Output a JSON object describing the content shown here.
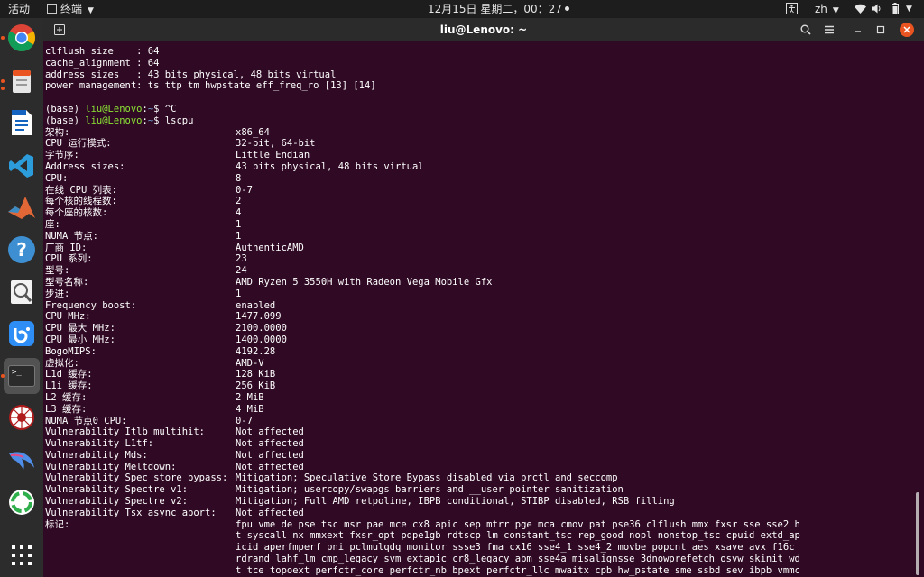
{
  "topbar": {
    "activities": "活动",
    "app_menu_label": "终端",
    "clock": "12月15日 星期二，00：27",
    "input_method": "zh"
  },
  "dock": {
    "items": [
      {
        "name": "chrome-icon",
        "label": ""
      },
      {
        "name": "files-icon",
        "label": ""
      },
      {
        "name": "libreoffice-writer-icon",
        "label": ""
      },
      {
        "name": "vscode-icon",
        "label": ""
      },
      {
        "name": "matlab-icon",
        "label": ""
      },
      {
        "name": "help-icon",
        "label": "?"
      },
      {
        "name": "image-viewer-icon",
        "label": ""
      },
      {
        "name": "baidu-netdisk-icon",
        "label": ""
      },
      {
        "name": "terminal-icon",
        "label": ">_"
      },
      {
        "name": "spider-icon",
        "label": ""
      },
      {
        "name": "kali-dragon-icon",
        "label": ""
      },
      {
        "name": "recycle-app-icon",
        "label": ""
      },
      {
        "name": "show-applications-icon",
        "label": ""
      }
    ]
  },
  "window": {
    "title": "liu@Lenovo: ~"
  },
  "terminal": {
    "pre_lines": [
      {
        "k": "clflush size    : 64"
      },
      {
        "k": "cache_alignment : 64"
      },
      {
        "k": "address sizes   : 43 bits physical, 48 bits virtual"
      },
      {
        "k": "power management: ts ttp tm hwpstate eff_freq_ro [13] [14]"
      },
      {
        "k": ""
      }
    ],
    "prompt1": {
      "env": "(base) ",
      "user": "liu@Lenovo",
      "colon": ":",
      "path": "~",
      "dollar": "$ ",
      "cmd": "^C"
    },
    "prompt2": {
      "env": "(base) ",
      "user": "liu@Lenovo",
      "colon": ":",
      "path": "~",
      "dollar": "$ ",
      "cmd": "lscpu"
    },
    "rows": [
      {
        "k": "架构:",
        "v": "x86_64"
      },
      {
        "k": "CPU 运行模式:",
        "v": "32-bit, 64-bit"
      },
      {
        "k": "字节序:",
        "v": "Little Endian"
      },
      {
        "k": "Address sizes:",
        "v": "43 bits physical, 48 bits virtual"
      },
      {
        "k": "CPU:",
        "v": "8"
      },
      {
        "k": "在线 CPU 列表:",
        "v": "0-7"
      },
      {
        "k": "每个核的线程数:",
        "v": "2"
      },
      {
        "k": "每个座的核数:",
        "v": "4"
      },
      {
        "k": "座:",
        "v": "1"
      },
      {
        "k": "NUMA 节点:",
        "v": "1"
      },
      {
        "k": "厂商 ID:",
        "v": "AuthenticAMD"
      },
      {
        "k": "CPU 系列:",
        "v": "23"
      },
      {
        "k": "型号:",
        "v": "24"
      },
      {
        "k": "型号名称:",
        "v": "AMD Ryzen 5 3550H with Radeon Vega Mobile Gfx"
      },
      {
        "k": "步进:",
        "v": "1"
      },
      {
        "k": "Frequency boost:",
        "v": "enabled"
      },
      {
        "k": "CPU MHz:",
        "v": "1477.099"
      },
      {
        "k": "CPU 最大 MHz:",
        "v": "2100.0000"
      },
      {
        "k": "CPU 最小 MHz:",
        "v": "1400.0000"
      },
      {
        "k": "BogoMIPS:",
        "v": "4192.28"
      },
      {
        "k": "虚拟化:",
        "v": "AMD-V"
      },
      {
        "k": "L1d 缓存:",
        "v": "128 KiB"
      },
      {
        "k": "L1i 缓存:",
        "v": "256 KiB"
      },
      {
        "k": "L2 缓存:",
        "v": "2 MiB"
      },
      {
        "k": "L3 缓存:",
        "v": "4 MiB"
      },
      {
        "k": "NUMA 节点0 CPU:",
        "v": "0-7"
      },
      {
        "k": "Vulnerability Itlb multihit:",
        "v": "Not affected"
      },
      {
        "k": "Vulnerability L1tf:",
        "v": "Not affected"
      },
      {
        "k": "Vulnerability Mds:",
        "v": "Not affected"
      },
      {
        "k": "Vulnerability Meltdown:",
        "v": "Not affected"
      },
      {
        "k": "Vulnerability Spec store bypass:",
        "v": "Mitigation; Speculative Store Bypass disabled via prctl and seccomp"
      },
      {
        "k": "Vulnerability Spectre v1:",
        "v": "Mitigation; usercopy/swapgs barriers and __user pointer sanitization"
      },
      {
        "k": "Vulnerability Spectre v2:",
        "v": "Mitigation; Full AMD retpoline, IBPB conditional, STIBP disabled, RSB filling"
      },
      {
        "k": "Vulnerability Tsx async abort:",
        "v": "Not affected"
      },
      {
        "k": "标记:",
        "v": "fpu vme de pse tsc msr pae mce cx8 apic sep mtrr pge mca cmov pat pse36 clflush mmx fxsr sse sse2 h"
      },
      {
        "k": "",
        "v": "t syscall nx mmxext fxsr_opt pdpe1gb rdtscp lm constant_tsc rep_good nopl nonstop_tsc cpuid extd_ap"
      },
      {
        "k": "",
        "v": "icid aperfmperf pni pclmulqdq monitor ssse3 fma cx16 sse4_1 sse4_2 movbe popcnt aes xsave avx f16c"
      },
      {
        "k": "",
        "v": "rdrand lahf_lm cmp_legacy svm extapic cr8_legacy abm sse4a misalignsse 3dnowprefetch osvw skinit wd"
      },
      {
        "k": "",
        "v": "t tce topoext perfctr_core perfctr_nb bpext perfctr_llc mwaitx cpb hw_pstate sme ssbd sev ibpb vmmc"
      }
    ]
  },
  "colors": {
    "terminal_bg": "#300a24",
    "prompt_user": "#8ae234",
    "prompt_path": "#729fcf",
    "close_button": "#e95420",
    "topbar_bg": "#1d1d1d",
    "dock_bg": "#2c2c2c"
  }
}
